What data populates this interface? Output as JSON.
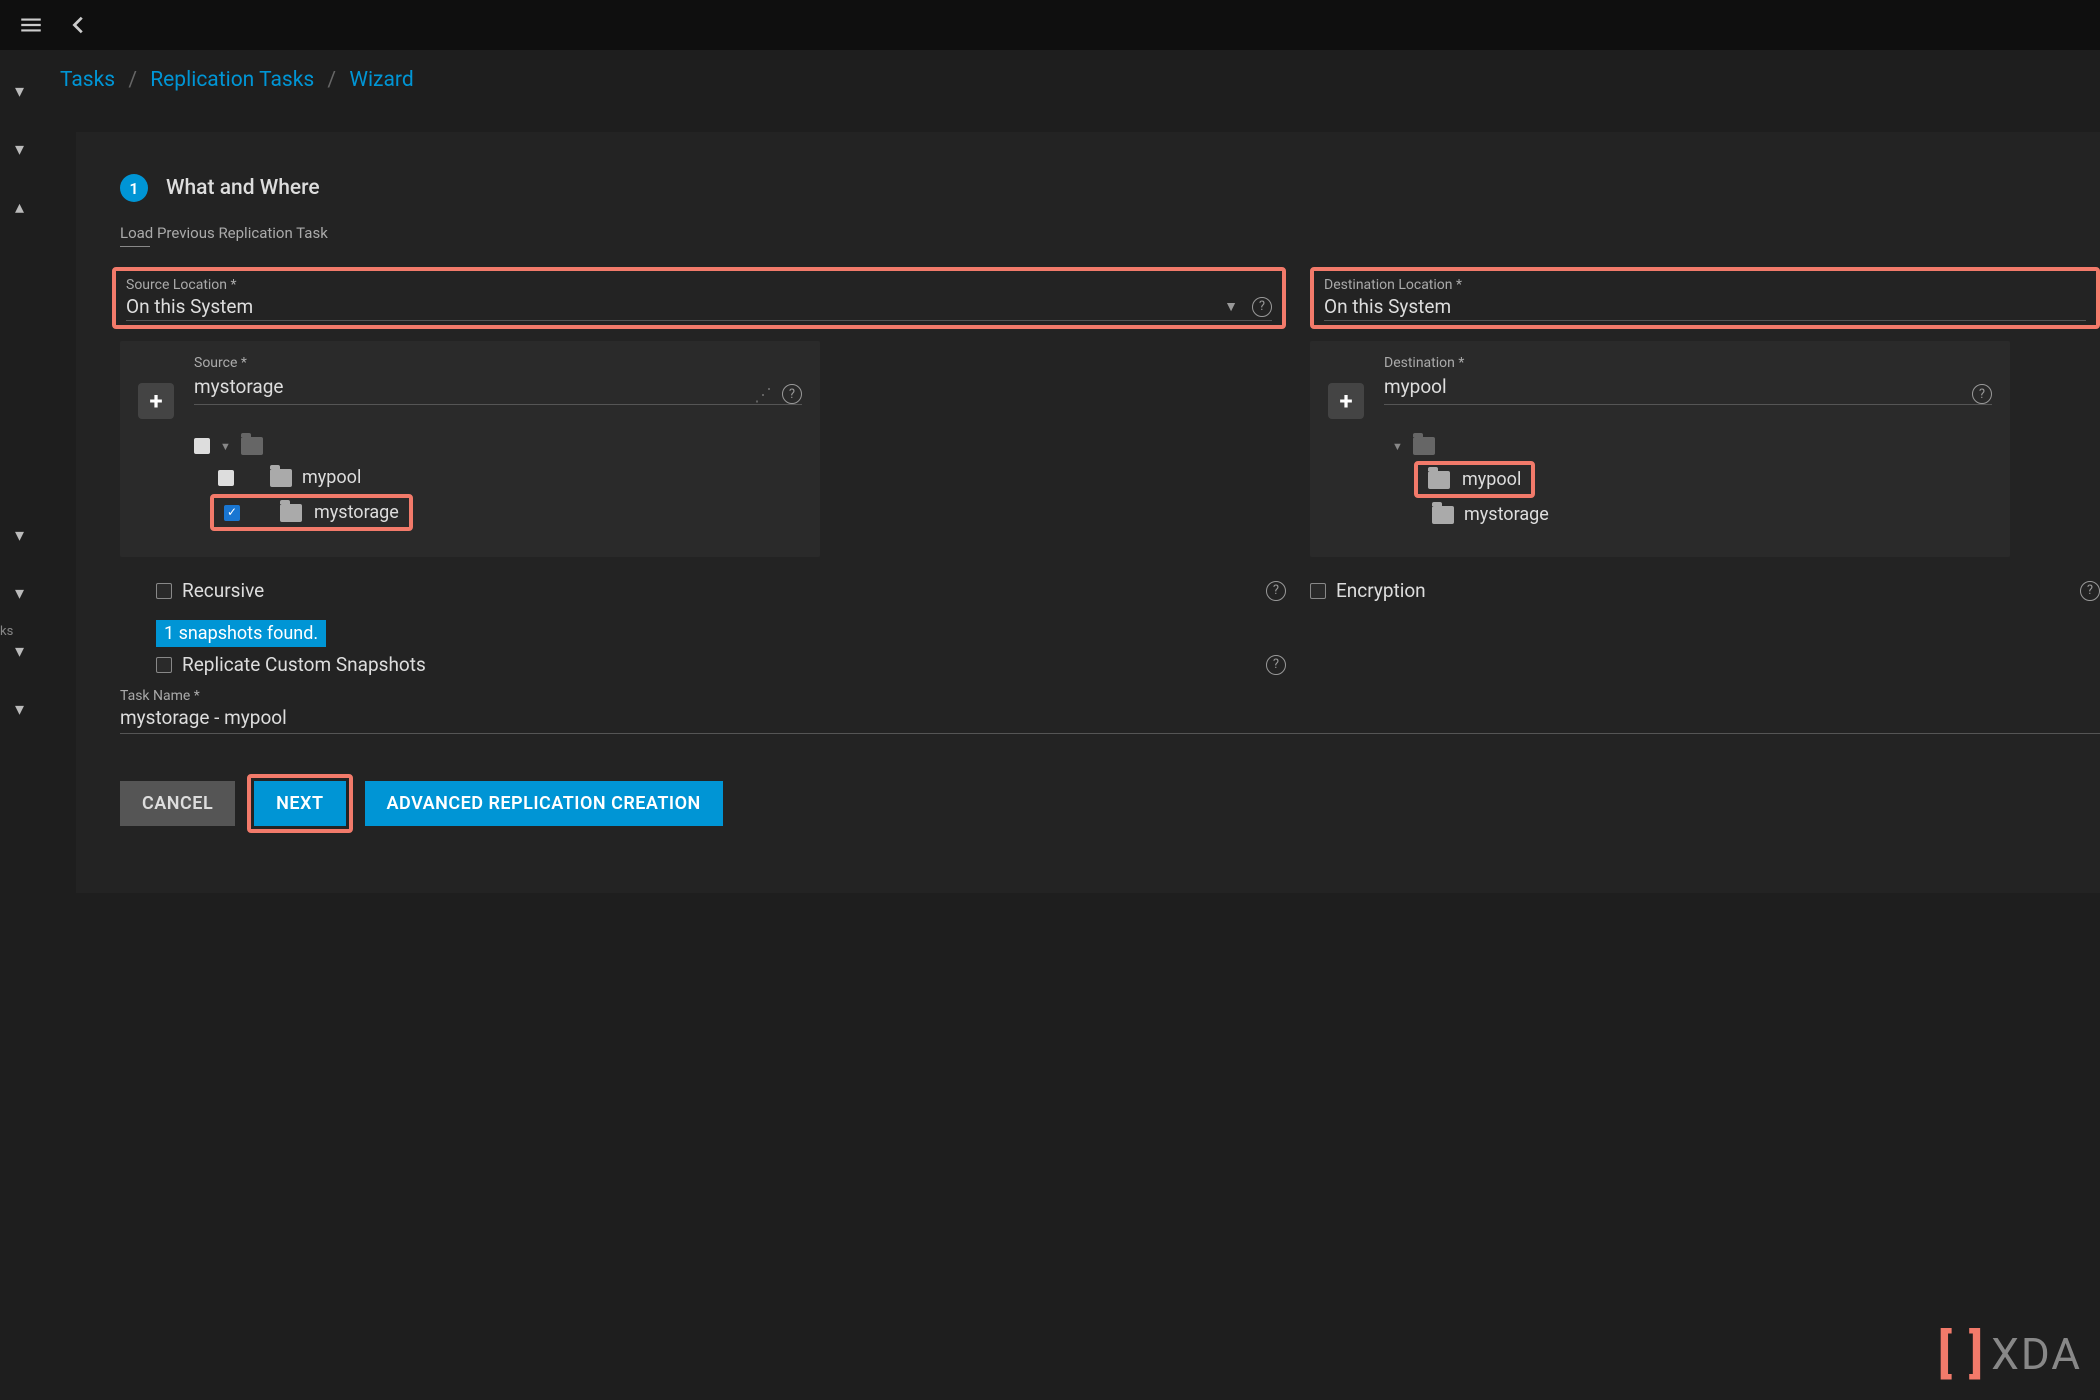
{
  "breadcrumbs": {
    "tasks": "Tasks",
    "replication": "Replication Tasks",
    "wizard": "Wizard"
  },
  "step": {
    "num": "1",
    "title": "What and Where"
  },
  "load_prev_label": "Load Previous Replication Task",
  "source": {
    "location_label": "Source Location *",
    "location_value": "On this System",
    "tree_label": "Source *",
    "tree_value": "mystorage",
    "items": {
      "mypool": "mypool",
      "mystorage": "mystorage"
    }
  },
  "destination": {
    "location_label": "Destination Location *",
    "location_value": "On this System",
    "tree_label": "Destination *",
    "tree_value": "mypool",
    "items": {
      "mypool": "mypool",
      "mystorage": "mystorage"
    }
  },
  "recursive_label": "Recursive",
  "encryption_label": "Encryption",
  "snapshots_found": "1 snapshots found.",
  "replicate_custom_label": "Replicate Custom Snapshots",
  "taskname_label": "Task Name *",
  "taskname_value": "mystorage - mypool",
  "buttons": {
    "cancel": "CANCEL",
    "next": "NEXT",
    "advanced": "ADVANCED REPLICATION CREATION"
  },
  "watermark": "XDA",
  "sidebar_fragment": "ks"
}
